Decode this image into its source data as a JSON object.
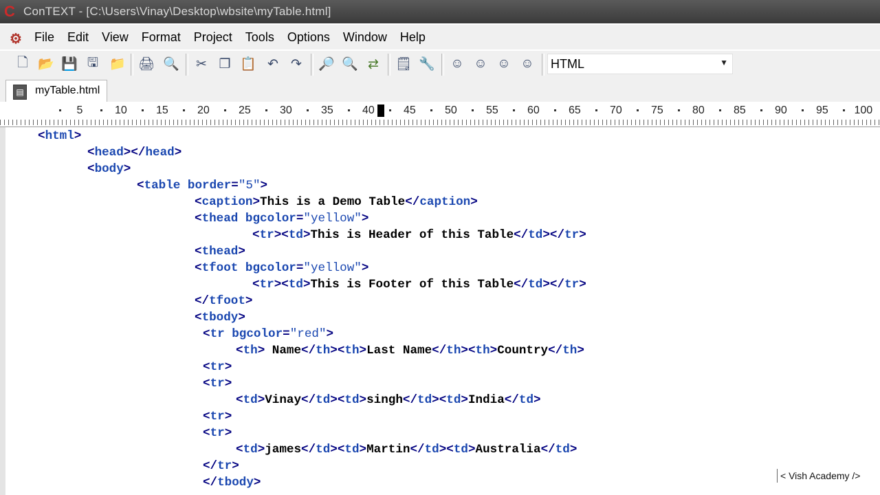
{
  "window": {
    "title": "ConTEXT - [C:\\Users\\Vinay\\Desktop\\wbsite\\myTable.html]"
  },
  "menu": [
    "File",
    "Edit",
    "View",
    "Format",
    "Project",
    "Tools",
    "Options",
    "Window",
    "Help"
  ],
  "toolbar": {
    "icons": [
      "new-file-icon",
      "open-folder-icon",
      "save-icon",
      "save-all-icon",
      "open-folder-2-icon",
      "print-icon",
      "print-preview-icon",
      "cut-icon",
      "copy-icon",
      "paste-icon",
      "undo-icon",
      "redo-icon",
      "find-icon",
      "find-next-icon",
      "replace-icon",
      "document-properties-icon",
      "tools-icon",
      "user-1-icon",
      "user-2-icon",
      "user-3-icon",
      "user-4-icon"
    ],
    "language": "HTML"
  },
  "tab": {
    "label": "myTable.html"
  },
  "ruler": {
    "marks": [
      "5",
      "10",
      "15",
      "20",
      "25",
      "30",
      "35",
      "40",
      "45",
      "50",
      "55",
      "60",
      "65",
      "70",
      "75",
      "80",
      "85",
      "90",
      "95",
      "100"
    ]
  },
  "code": [
    [
      [
        "pun",
        "<"
      ],
      [
        "tag",
        "html"
      ],
      [
        "pun",
        ">"
      ]
    ],
    [
      [
        "pun",
        "<"
      ],
      [
        "tag",
        "head"
      ],
      [
        "pun",
        "></"
      ],
      [
        "tag",
        "head"
      ],
      [
        "pun",
        ">"
      ]
    ],
    [
      [
        "pun",
        "<"
      ],
      [
        "tag",
        "body"
      ],
      [
        "pun",
        ">"
      ]
    ],
    [
      [
        "pun",
        "<"
      ],
      [
        "tag",
        "table"
      ],
      [
        "txt",
        " "
      ],
      [
        "attr",
        "border"
      ],
      [
        "pun",
        "="
      ],
      [
        "str",
        "\"5\""
      ],
      [
        "pun",
        ">"
      ]
    ],
    [
      [
        "pun",
        "<"
      ],
      [
        "tag",
        "caption"
      ],
      [
        "pun",
        ">"
      ],
      [
        "txt",
        "This is a Demo Table"
      ],
      [
        "pun",
        "</"
      ],
      [
        "tag",
        "caption"
      ],
      [
        "pun",
        ">"
      ]
    ],
    [
      [
        "pun",
        "<"
      ],
      [
        "tag",
        "thead"
      ],
      [
        "txt",
        " "
      ],
      [
        "attr",
        "bgcolor"
      ],
      [
        "pun",
        "="
      ],
      [
        "str",
        "\"yellow\""
      ],
      [
        "pun",
        ">"
      ]
    ],
    [
      [
        "pun",
        "<"
      ],
      [
        "tag",
        "tr"
      ],
      [
        "pun",
        "><"
      ],
      [
        "tag",
        "td"
      ],
      [
        "pun",
        ">"
      ],
      [
        "txt",
        "This is Header of this Table"
      ],
      [
        "pun",
        "</"
      ],
      [
        "tag",
        "td"
      ],
      [
        "pun",
        "></"
      ],
      [
        "tag",
        "tr"
      ],
      [
        "pun",
        ">"
      ]
    ],
    [
      [
        "pun",
        "<"
      ],
      [
        "tag",
        "thead"
      ],
      [
        "pun",
        ">"
      ]
    ],
    [
      [
        "pun",
        "<"
      ],
      [
        "tag",
        "tfoot"
      ],
      [
        "txt",
        " "
      ],
      [
        "attr",
        "bgcolor"
      ],
      [
        "pun",
        "="
      ],
      [
        "str",
        "\"yellow\""
      ],
      [
        "pun",
        ">"
      ]
    ],
    [
      [
        "pun",
        "<"
      ],
      [
        "tag",
        "tr"
      ],
      [
        "pun",
        "><"
      ],
      [
        "tag",
        "td"
      ],
      [
        "pun",
        ">"
      ],
      [
        "txt",
        "This is Footer of this Table"
      ],
      [
        "pun",
        "</"
      ],
      [
        "tag",
        "td"
      ],
      [
        "pun",
        "></"
      ],
      [
        "tag",
        "tr"
      ],
      [
        "pun",
        ">"
      ]
    ],
    [
      [
        "pun",
        "</"
      ],
      [
        "tag",
        "tfoot"
      ],
      [
        "pun",
        ">"
      ]
    ],
    [
      [
        "pun",
        "<"
      ],
      [
        "tag",
        "tbody"
      ],
      [
        "pun",
        ">"
      ]
    ],
    [
      [
        "pun",
        "<"
      ],
      [
        "tag",
        "tr"
      ],
      [
        "txt",
        " "
      ],
      [
        "attr",
        "bgcolor"
      ],
      [
        "pun",
        "="
      ],
      [
        "str",
        "\"red\""
      ],
      [
        "pun",
        ">"
      ]
    ],
    [
      [
        "pun",
        "<"
      ],
      [
        "tag",
        "th"
      ],
      [
        "pun",
        ">"
      ],
      [
        "txt",
        " Name"
      ],
      [
        "pun",
        "</"
      ],
      [
        "tag",
        "th"
      ],
      [
        "pun",
        "><"
      ],
      [
        "tag",
        "th"
      ],
      [
        "pun",
        ">"
      ],
      [
        "txt",
        "Last Name"
      ],
      [
        "pun",
        "</"
      ],
      [
        "tag",
        "th"
      ],
      [
        "pun",
        "><"
      ],
      [
        "tag",
        "th"
      ],
      [
        "pun",
        ">"
      ],
      [
        "txt",
        "Country"
      ],
      [
        "pun",
        "</"
      ],
      [
        "tag",
        "th"
      ],
      [
        "pun",
        ">"
      ]
    ],
    [
      [
        "pun",
        "<"
      ],
      [
        "tag",
        "tr"
      ],
      [
        "pun",
        ">"
      ]
    ],
    [
      [
        "pun",
        "<"
      ],
      [
        "tag",
        "tr"
      ],
      [
        "pun",
        ">"
      ]
    ],
    [
      [
        "pun",
        "<"
      ],
      [
        "tag",
        "td"
      ],
      [
        "pun",
        ">"
      ],
      [
        "txt",
        "Vinay"
      ],
      [
        "pun",
        "</"
      ],
      [
        "tag",
        "td"
      ],
      [
        "pun",
        "><"
      ],
      [
        "tag",
        "td"
      ],
      [
        "pun",
        ">"
      ],
      [
        "txt",
        "singh"
      ],
      [
        "pun",
        "</"
      ],
      [
        "tag",
        "td"
      ],
      [
        "pun",
        "><"
      ],
      [
        "tag",
        "td"
      ],
      [
        "pun",
        ">"
      ],
      [
        "txt",
        "India"
      ],
      [
        "pun",
        "</"
      ],
      [
        "tag",
        "td"
      ],
      [
        "pun",
        ">"
      ]
    ],
    [
      [
        "pun",
        "<"
      ],
      [
        "tag",
        "tr"
      ],
      [
        "pun",
        ">"
      ]
    ],
    [
      [
        "pun",
        "<"
      ],
      [
        "tag",
        "tr"
      ],
      [
        "pun",
        ">"
      ]
    ],
    [
      [
        "pun",
        "<"
      ],
      [
        "tag",
        "td"
      ],
      [
        "pun",
        ">"
      ],
      [
        "txt",
        "james"
      ],
      [
        "pun",
        "</"
      ],
      [
        "tag",
        "td"
      ],
      [
        "pun",
        "><"
      ],
      [
        "tag",
        "td"
      ],
      [
        "pun",
        ">"
      ],
      [
        "txt",
        "Martin"
      ],
      [
        "pun",
        "</"
      ],
      [
        "tag",
        "td"
      ],
      [
        "pun",
        "><"
      ],
      [
        "tag",
        "td"
      ],
      [
        "pun",
        ">"
      ],
      [
        "txt",
        "Australia"
      ],
      [
        "pun",
        "</"
      ],
      [
        "tag",
        "td"
      ],
      [
        "pun",
        ">"
      ]
    ],
    [
      [
        "pun",
        "</"
      ],
      [
        "tag",
        "tr"
      ],
      [
        "pun",
        ">"
      ]
    ],
    [
      [
        "pun",
        "</"
      ],
      [
        "tag",
        "tbody"
      ],
      [
        "pun",
        ">"
      ]
    ]
  ],
  "watermark": "< Vish Academy />",
  "colors": {
    "tag": "#1a47b0",
    "punct": "#000080",
    "text": "#000000"
  }
}
